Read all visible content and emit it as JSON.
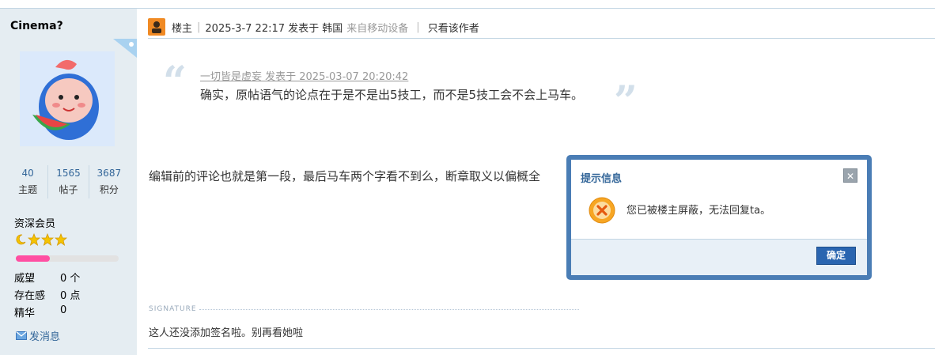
{
  "author": {
    "username": "Cinema?",
    "stats": [
      {
        "value": "40",
        "label": "主题"
      },
      {
        "value": "1565",
        "label": "帖子"
      },
      {
        "value": "3687",
        "label": "积分"
      }
    ],
    "rank": "资深会员",
    "level_progress": 0.33,
    "fields": [
      {
        "key": "威望",
        "value": "0 个"
      },
      {
        "key": "存在感",
        "value": "0 点"
      },
      {
        "key": "精华",
        "value": "0"
      }
    ],
    "send_message": "发消息"
  },
  "post": {
    "floor_label": "楼主",
    "time_text": "2025-3-7 22:17 发表于 韩国",
    "device_text": "来自移动设备",
    "only_author": "只看该作者",
    "quote": {
      "meta": "一切皆是虚妄 发表于 2025-03-07 20:20:42",
      "text": "确实，原帖语气的论点在于是不是出5技工，而不是5技工会不会上马车。"
    },
    "body": "编辑前的评论也就是第一段，最后马车两个字看不到么，断章取义以偏概全",
    "signature_label": "SIGNATURE",
    "signature": "这人还没添加签名啦。别再看她啦"
  },
  "dialog": {
    "title": "提示信息",
    "message": "您已被楼主屏蔽，无法回复ta。",
    "ok_label": "确定",
    "close_icon": "close-icon",
    "status_icon": "error-icon"
  },
  "colors": {
    "sidebar_bg": "#e5edf2",
    "link": "#336699",
    "dialog_frame": "#4a7db5",
    "progress": "#ff4fa2"
  }
}
